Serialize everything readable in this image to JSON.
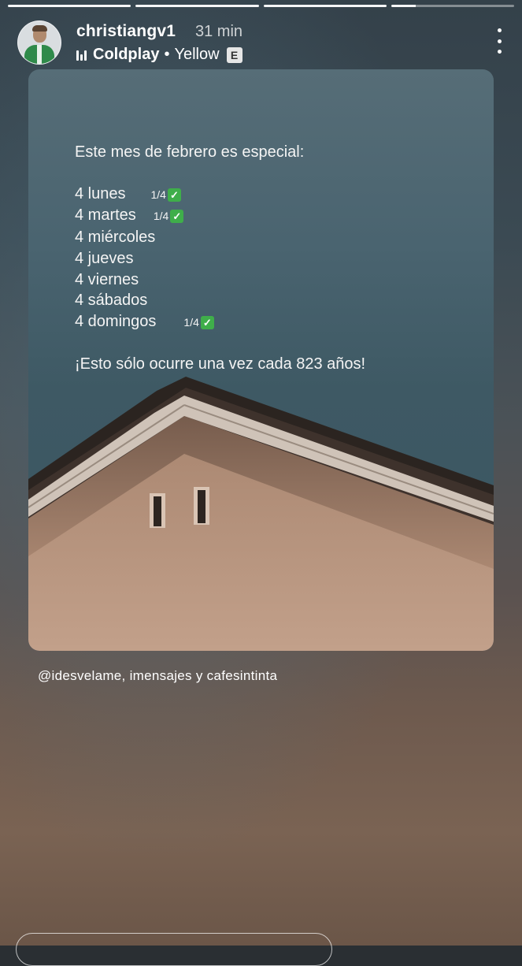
{
  "story": {
    "progress_segments": 4,
    "active_segment_progress": 0.2,
    "username": "christiangv1",
    "time_ago": "31 min",
    "music": {
      "artist": "Coldplay",
      "separator": "•",
      "song": "Yellow",
      "explicit_badge": "E"
    },
    "icons": {
      "menu": "more-vertical-icon",
      "music": "music-bars-icon",
      "check": "check-mark-icon"
    }
  },
  "post": {
    "heading": "Este mes de febrero es especial:",
    "days": [
      {
        "label": "4 lunes",
        "tally": "1/4",
        "checked": true
      },
      {
        "label": "4 martes",
        "tally": "1/4",
        "checked": true
      },
      {
        "label": "4 miércoles",
        "tally": "",
        "checked": false
      },
      {
        "label": "4 jueves",
        "tally": "",
        "checked": false
      },
      {
        "label": "4 viernes",
        "tally": "",
        "checked": false
      },
      {
        "label": "4 sábados",
        "tally": "",
        "checked": false
      },
      {
        "label": "4 domingos",
        "tally": "1/4",
        "checked": true
      }
    ],
    "closing": "¡Esto sólo ocurre una vez cada 823 años!"
  },
  "mentions": "@idesvelame, imensajes y cafesintinta",
  "colors": {
    "check_green": "#3fae4a",
    "card_sky": "#4a6470",
    "wall": "#b69580"
  }
}
